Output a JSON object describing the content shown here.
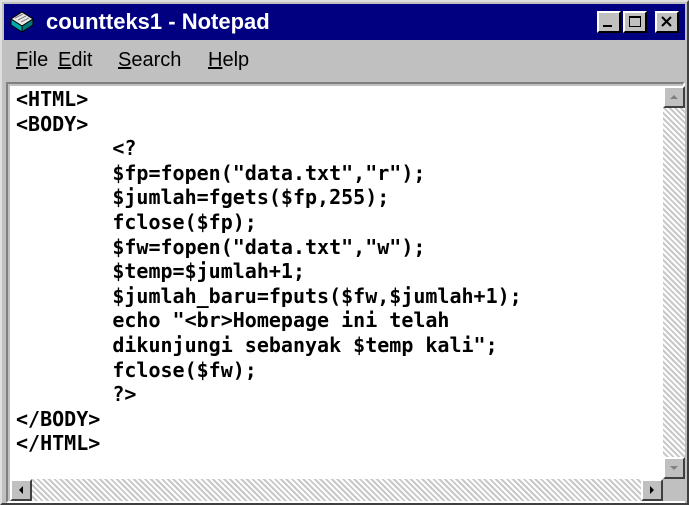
{
  "window": {
    "title": "countteks1 - Notepad",
    "title_bar_color": "#000080",
    "icon": "notepad-icon"
  },
  "menu": {
    "file": {
      "accel": "F",
      "rest": "ile"
    },
    "edit": {
      "accel": "E",
      "rest": "dit"
    },
    "search": {
      "accel": "S",
      "rest": "earch"
    },
    "help": {
      "accel": "H",
      "rest": "elp"
    }
  },
  "editor": {
    "lines": [
      "<HTML>",
      "<BODY>",
      "        <?",
      "        $fp=fopen(\"data.txt\",\"r\");",
      "        $jumlah=fgets($fp,255);",
      "        fclose($fp);",
      "        $fw=fopen(\"data.txt\",\"w\");",
      "        $temp=$jumlah+1;",
      "        $jumlah_baru=fputs($fw,$jumlah+1);",
      "        echo \"<br>Homepage ini telah",
      "        dikunjungi sebanyak $temp kali\";",
      "        fclose($fw);",
      "        ?>",
      "</BODY>",
      "</HTML>"
    ]
  },
  "icons": [
    "notepad-icon",
    "minimize-icon",
    "maximize-icon",
    "close-icon",
    "scroll-up-icon",
    "scroll-down-icon",
    "scroll-left-icon",
    "scroll-right-icon"
  ]
}
